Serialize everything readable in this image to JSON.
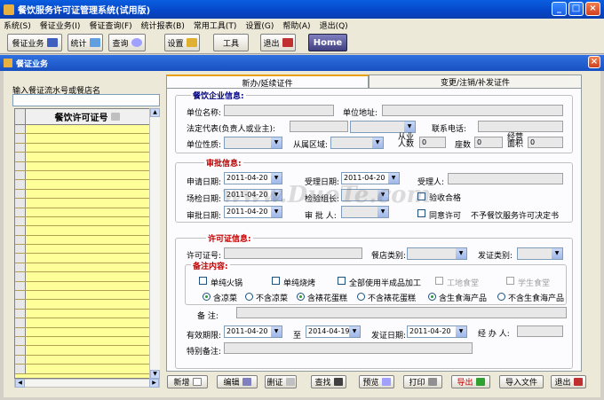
{
  "window": {
    "title": "餐饮服务许可证管理系统(试用版)"
  },
  "menu": [
    "系统(S)",
    "餐证业务(I)",
    "餐证查询(F)",
    "统计报表(B)",
    "常用工具(T)",
    "设置(G)",
    "帮助(A)",
    "退出(Q)"
  ],
  "toolbar": {
    "b1": "餐证业务",
    "b2": "统计",
    "b3": "查询",
    "b4": "设置",
    "b5": "工具",
    "b6": "退出",
    "home": "Home"
  },
  "sub": {
    "title": "餐证业务"
  },
  "left": {
    "label": "输入餐证流水号或餐店名",
    "col": "餐饮许可证号"
  },
  "tabs": {
    "t1": "新办/延续证件",
    "t2": "变更/注销/补发证件"
  },
  "g1": {
    "title": "餐饮企业信息:",
    "unit_name": "单位名称:",
    "unit_addr": "单位地址:",
    "legal": "法定代表(负责人或业主):",
    "phone": "联系电话:",
    "nature": "单位性质:",
    "area": "从属区域:",
    "staff": "从业人数",
    "staff_v": "0",
    "seats": "座数",
    "seats_v": "0",
    "area2": "经营面积",
    "area2_v": "0"
  },
  "g2": {
    "title": "审批信息:",
    "apply": "申请日期:",
    "apply_v": "2011-04-20",
    "accept": "受理日期:",
    "accept_v": "2011-04-20",
    "acceptor": "受理人:",
    "inspect": "场检日期:",
    "inspect_v": "2011-04-20",
    "leader": "检验组长:",
    "pass": "验收合格",
    "approve": "审批日期:",
    "approve_v": "2011-04-20",
    "approver": "审 批 人:",
    "agree": "同意许可",
    "deny": "不予餐饮服务许可决定书"
  },
  "g3": {
    "title": "许可证信息:",
    "lic": "许可证号:",
    "shoptype": "餐店类别:",
    "issuetype": "发证类别:",
    "remark_title": "备注内容:",
    "c1": "单纯火锅",
    "c2": "单纯烧烤",
    "c3": "全部使用半成品加工",
    "c4": "工地食堂",
    "c5": "学生食堂",
    "r1": "含凉菜",
    "r2": "不含凉菜",
    "r3": "含裱花蛋糕",
    "r4": "不含裱花蛋糕",
    "r5": "含生食海产品",
    "r6": "不含生食海产品",
    "note": "备    注:",
    "valid": "有效期限:",
    "valid_from": "2011-04-20",
    "to": "至",
    "valid_to": "2014-04-19",
    "issue": "发证日期:",
    "issue_v": "2011-04-20",
    "handler": "经 办 人:",
    "special": "特别备注:"
  },
  "buttons": {
    "add": "新增",
    "edit": "编辑",
    "del": "删证",
    "find": "查找",
    "preview": "预览",
    "print": "打印",
    "export": "导出",
    "import": "导入文件",
    "quit": "退出"
  },
  "watermark": "www.DuoTe.com"
}
